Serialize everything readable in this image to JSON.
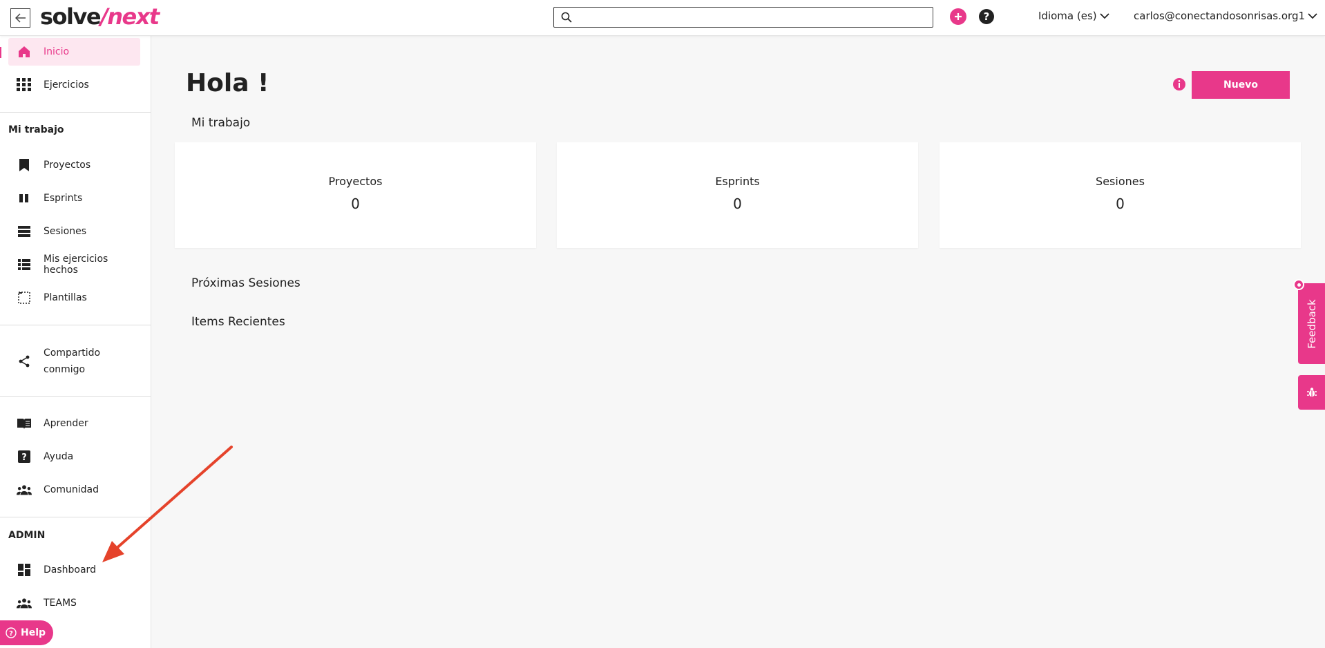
{
  "brand": {
    "part1": "solve",
    "part2": "/next",
    "accent": "#e8388a"
  },
  "topbar": {
    "search_placeholder": "",
    "language": "Idioma (es)",
    "user": "carlos@conectandosonrisas.org1"
  },
  "sidebar": {
    "top_items": [
      {
        "label": "Inicio",
        "icon": "home-icon",
        "active": true
      },
      {
        "label": "Ejercicios",
        "icon": "grid-icon"
      }
    ],
    "my_work_title": "Mi trabajo",
    "my_work_items": [
      {
        "label": "Proyectos",
        "icon": "bookmark-icon"
      },
      {
        "label": "Esprints",
        "icon": "columns-icon"
      },
      {
        "label": "Sesiones",
        "icon": "stack-icon"
      },
      {
        "label": "Mis ejercicios hechos",
        "icon": "list-icon"
      },
      {
        "label": "Plantillas",
        "icon": "template-icon"
      }
    ],
    "shared": {
      "line1": "Compartido",
      "line2": "conmigo",
      "icon": "share-icon"
    },
    "help_items": [
      {
        "label": "Aprender",
        "icon": "book-icon"
      },
      {
        "label": "Ayuda",
        "icon": "question-icon"
      },
      {
        "label": "Comunidad",
        "icon": "people-icon"
      }
    ],
    "admin_title": "ADMIN",
    "admin_items": [
      {
        "label": "Dashboard",
        "icon": "dashboard-icon"
      },
      {
        "label": "TEAMS",
        "icon": "people-icon"
      }
    ],
    "help_pill": "Help"
  },
  "main": {
    "greeting": "Hola !",
    "new_button": "Nuevo",
    "my_work_heading": "Mi trabajo",
    "cards": [
      {
        "title": "Proyectos",
        "value": "0"
      },
      {
        "title": "Esprints",
        "value": "0"
      },
      {
        "title": "Sesiones",
        "value": "0"
      }
    ],
    "upcoming_heading": "Próximas Sesiones",
    "recent_heading": "Items Recientes"
  },
  "feedback": {
    "label": "Feedback"
  }
}
